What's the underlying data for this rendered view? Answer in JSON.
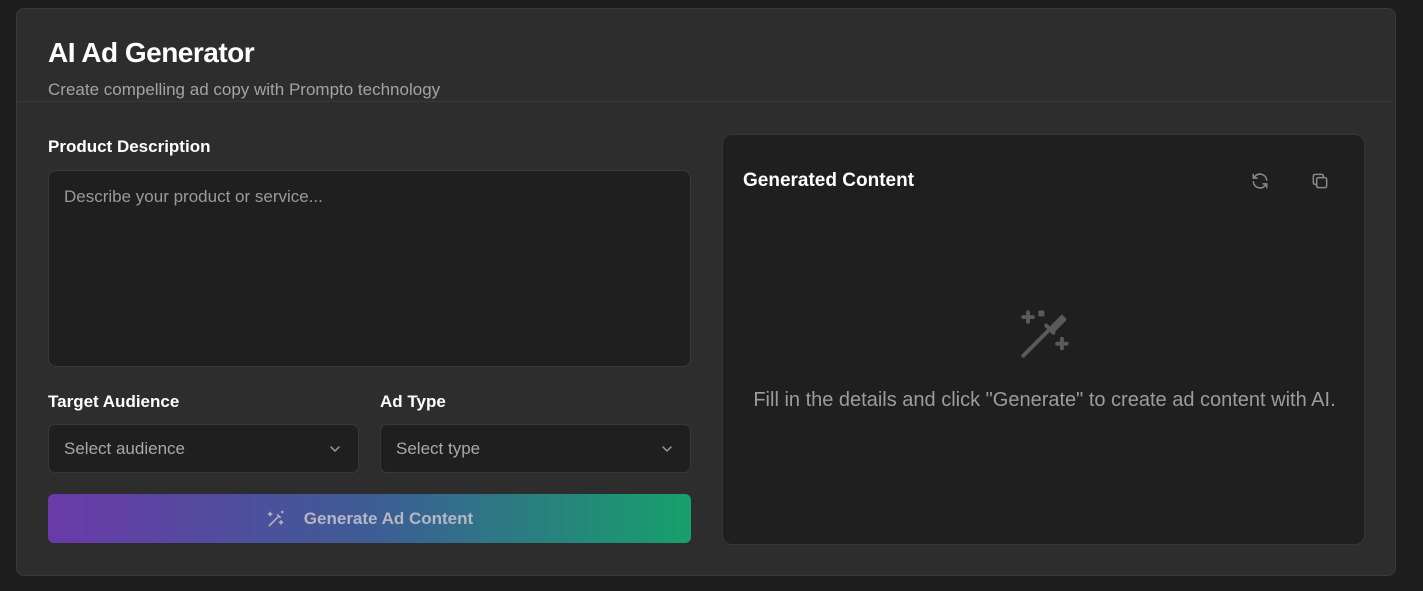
{
  "header": {
    "title": "AI Ad Generator",
    "subtitle": "Create compelling ad copy with Prompto technology"
  },
  "form": {
    "product_label": "Product Description",
    "product_placeholder": "Describe your product or service...",
    "audience_label": "Target Audience",
    "audience_value": "Select audience",
    "type_label": "Ad Type",
    "type_value": "Select type",
    "generate_label": "Generate Ad Content"
  },
  "output": {
    "title": "Generated Content",
    "empty_message": "Fill in the details and click \"Generate\" to create ad content with AI."
  },
  "icons": {
    "refresh": "refresh-icon",
    "copy": "copy-icon",
    "wand": "magic-wand-icon",
    "chevron": "chevron-down-icon"
  },
  "colors": {
    "background": "#1d1d1d",
    "card": "#2d2d2d",
    "input": "#1f1f1f",
    "gradient_start": "#6a3aa8",
    "gradient_end": "#17a06a"
  }
}
